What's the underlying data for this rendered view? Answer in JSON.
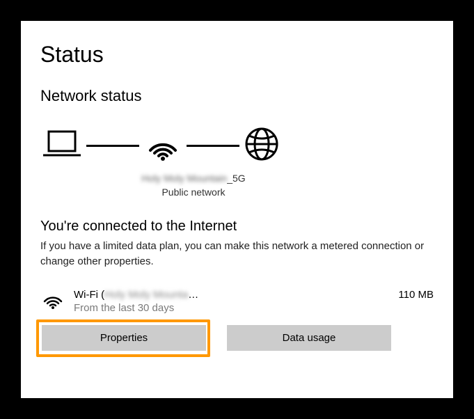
{
  "page": {
    "title": "Status",
    "section_title": "Network status"
  },
  "network": {
    "name_obscured": "Holy Moly Mountain",
    "name_suffix": "_5G",
    "type": "Public network"
  },
  "status": {
    "headline": "You're connected to the Internet",
    "description": "If you have a limited data plan, you can make this network a metered connection or change other properties."
  },
  "connection": {
    "prefix": "Wi-Fi (",
    "name_obscured": "Holy Moly Mounta",
    "suffix": "…",
    "subtext": "From the last 30 days",
    "data_amount": "110 MB"
  },
  "buttons": {
    "properties": "Properties",
    "data_usage": "Data usage"
  }
}
